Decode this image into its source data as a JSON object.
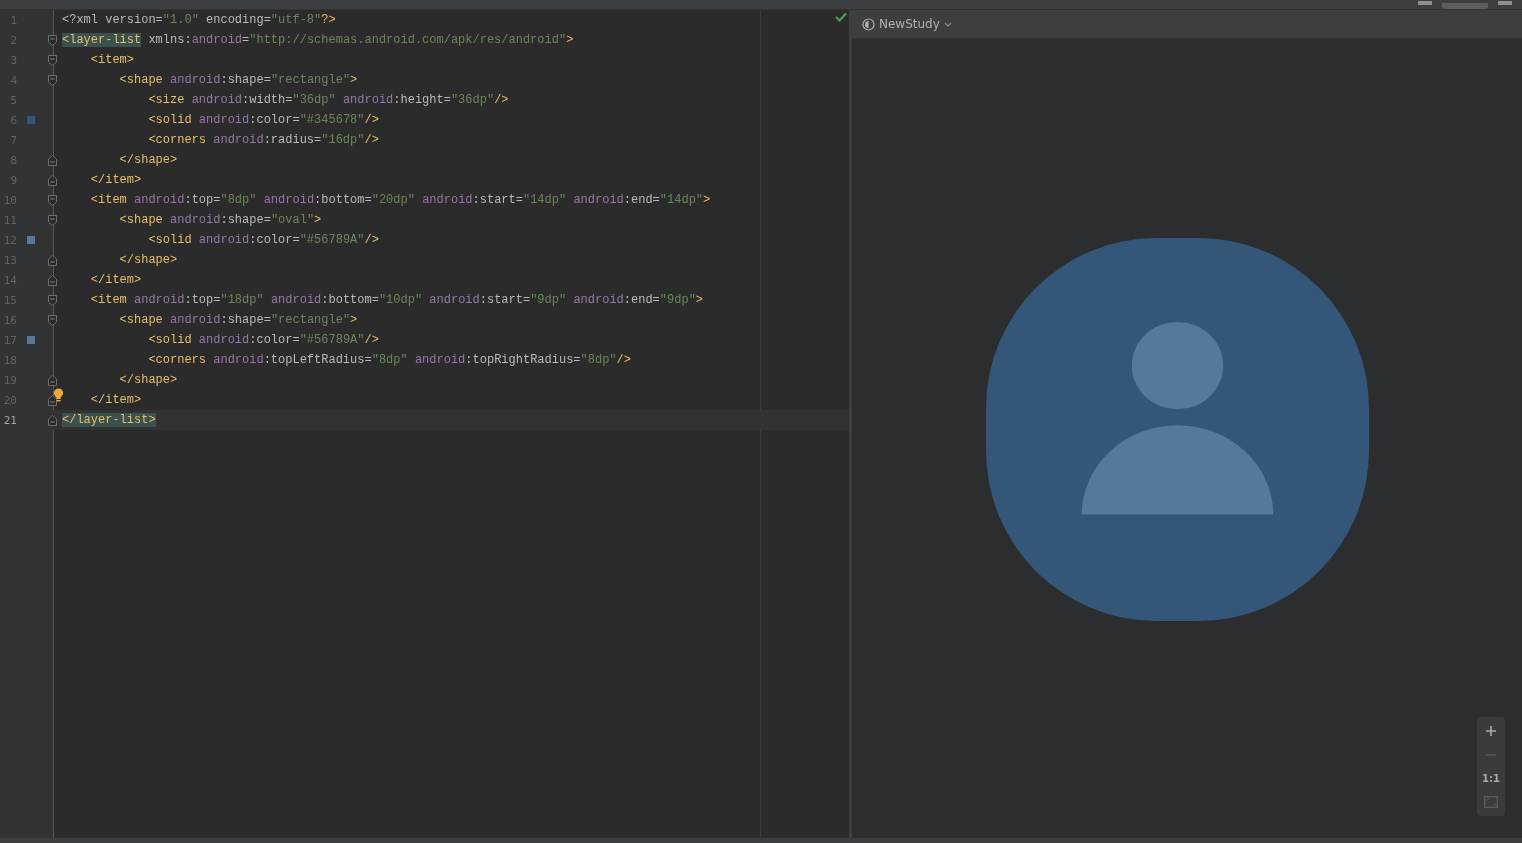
{
  "editor": {
    "lines": [
      {
        "number": "1",
        "kind": "plain",
        "bulb": false,
        "current": false,
        "tokens": [
          {
            "kind": "attr",
            "text": "<?xml version="
          },
          {
            "kind": "value",
            "text": "\"1.0\""
          },
          {
            "kind": "attr",
            "text": " encoding="
          },
          {
            "kind": "value",
            "text": "\"utf-8\""
          },
          {
            "kind": "tag",
            "text": "?>"
          }
        ]
      },
      {
        "number": "2",
        "kind": "open",
        "bulb": false,
        "current": false,
        "tokens": [
          {
            "kind": "match",
            "text": "<layer-list"
          },
          {
            "kind": "attr",
            "text": " xmlns:"
          },
          {
            "kind": "ns",
            "text": "android"
          },
          {
            "kind": "attr",
            "text": "="
          },
          {
            "kind": "value",
            "text": "\"http://schemas.android.com/apk/res/android\""
          },
          {
            "kind": "tag",
            "text": ">"
          }
        ]
      },
      {
        "number": "3",
        "kind": "open",
        "bulb": false,
        "current": false,
        "tokens": [
          {
            "kind": "tag",
            "text": "    <item>"
          }
        ]
      },
      {
        "number": "4",
        "kind": "open",
        "bulb": false,
        "current": false,
        "tokens": [
          {
            "kind": "tag",
            "text": "        <shape "
          },
          {
            "kind": "ns",
            "text": "android"
          },
          {
            "kind": "attr",
            "text": ":shape="
          },
          {
            "kind": "value",
            "text": "\"rectangle\""
          },
          {
            "kind": "tag",
            "text": ">"
          }
        ]
      },
      {
        "number": "5",
        "kind": "plain",
        "bulb": false,
        "current": false,
        "tokens": [
          {
            "kind": "tag",
            "text": "            <size "
          },
          {
            "kind": "ns",
            "text": "android"
          },
          {
            "kind": "attr",
            "text": ":width="
          },
          {
            "kind": "value",
            "text": "\"36dp\" "
          },
          {
            "kind": "ns",
            "text": "android"
          },
          {
            "kind": "attr",
            "text": ":height="
          },
          {
            "kind": "value",
            "text": "\"36dp\""
          },
          {
            "kind": "tag",
            "text": "/>"
          }
        ]
      },
      {
        "number": "6",
        "kind": "plain",
        "color": "#345678",
        "bulb": false,
        "current": false,
        "tokens": [
          {
            "kind": "tag",
            "text": "            <solid "
          },
          {
            "kind": "ns",
            "text": "android"
          },
          {
            "kind": "attr",
            "text": ":color="
          },
          {
            "kind": "value",
            "text": "\"#345678\""
          },
          {
            "kind": "tag",
            "text": "/>"
          }
        ]
      },
      {
        "number": "7",
        "kind": "plain",
        "bulb": false,
        "current": false,
        "tokens": [
          {
            "kind": "tag",
            "text": "            <corners "
          },
          {
            "kind": "ns",
            "text": "android"
          },
          {
            "kind": "attr",
            "text": ":radius="
          },
          {
            "kind": "value",
            "text": "\"16dp\""
          },
          {
            "kind": "tag",
            "text": "/>"
          }
        ]
      },
      {
        "number": "8",
        "kind": "close",
        "bulb": false,
        "current": false,
        "tokens": [
          {
            "kind": "tag",
            "text": "        </shape>"
          }
        ]
      },
      {
        "number": "9",
        "kind": "close",
        "bulb": false,
        "current": false,
        "tokens": [
          {
            "kind": "tag",
            "text": "    </item>"
          }
        ]
      },
      {
        "number": "10",
        "kind": "open",
        "bulb": false,
        "current": false,
        "tokens": [
          {
            "kind": "tag",
            "text": "    <item "
          },
          {
            "kind": "ns",
            "text": "android"
          },
          {
            "kind": "attr",
            "text": ":top="
          },
          {
            "kind": "value",
            "text": "\"8dp\" "
          },
          {
            "kind": "ns",
            "text": "android"
          },
          {
            "kind": "attr",
            "text": ":bottom="
          },
          {
            "kind": "value",
            "text": "\"20dp\" "
          },
          {
            "kind": "ns",
            "text": "android"
          },
          {
            "kind": "attr",
            "text": ":start="
          },
          {
            "kind": "value",
            "text": "\"14dp\" "
          },
          {
            "kind": "ns",
            "text": "android"
          },
          {
            "kind": "attr",
            "text": ":end="
          },
          {
            "kind": "value",
            "text": "\"14dp\""
          },
          {
            "kind": "tag",
            "text": ">"
          }
        ]
      },
      {
        "number": "11",
        "kind": "open",
        "bulb": false,
        "current": false,
        "tokens": [
          {
            "kind": "tag",
            "text": "        <shape "
          },
          {
            "kind": "ns",
            "text": "android"
          },
          {
            "kind": "attr",
            "text": ":shape="
          },
          {
            "kind": "value",
            "text": "\"oval\""
          },
          {
            "kind": "tag",
            "text": ">"
          }
        ]
      },
      {
        "number": "12",
        "kind": "plain",
        "color": "#56789a",
        "bulb": false,
        "current": false,
        "tokens": [
          {
            "kind": "tag",
            "text": "            <solid "
          },
          {
            "kind": "ns",
            "text": "android"
          },
          {
            "kind": "attr",
            "text": ":color="
          },
          {
            "kind": "value",
            "text": "\"#56789A\""
          },
          {
            "kind": "tag",
            "text": "/>"
          }
        ]
      },
      {
        "number": "13",
        "kind": "close",
        "bulb": false,
        "current": false,
        "tokens": [
          {
            "kind": "tag",
            "text": "        </shape>"
          }
        ]
      },
      {
        "number": "14",
        "kind": "close",
        "bulb": false,
        "current": false,
        "tokens": [
          {
            "kind": "tag",
            "text": "    </item>"
          }
        ]
      },
      {
        "number": "15",
        "kind": "open",
        "bulb": false,
        "current": false,
        "tokens": [
          {
            "kind": "tag",
            "text": "    <item "
          },
          {
            "kind": "ns",
            "text": "android"
          },
          {
            "kind": "attr",
            "text": ":top="
          },
          {
            "kind": "value",
            "text": "\"18dp\" "
          },
          {
            "kind": "ns",
            "text": "android"
          },
          {
            "kind": "attr",
            "text": ":bottom="
          },
          {
            "kind": "value",
            "text": "\"10dp\" "
          },
          {
            "kind": "ns",
            "text": "android"
          },
          {
            "kind": "attr",
            "text": ":start="
          },
          {
            "kind": "value",
            "text": "\"9dp\" "
          },
          {
            "kind": "ns",
            "text": "android"
          },
          {
            "kind": "attr",
            "text": ":end="
          },
          {
            "kind": "value",
            "text": "\"9dp\""
          },
          {
            "kind": "tag",
            "text": ">"
          }
        ]
      },
      {
        "number": "16",
        "kind": "open",
        "bulb": false,
        "current": false,
        "tokens": [
          {
            "kind": "tag",
            "text": "        <shape "
          },
          {
            "kind": "ns",
            "text": "android"
          },
          {
            "kind": "attr",
            "text": ":shape="
          },
          {
            "kind": "value",
            "text": "\"rectangle\""
          },
          {
            "kind": "tag",
            "text": ">"
          }
        ]
      },
      {
        "number": "17",
        "kind": "plain",
        "color": "#56789a",
        "bulb": false,
        "current": false,
        "tokens": [
          {
            "kind": "tag",
            "text": "            <solid "
          },
          {
            "kind": "ns",
            "text": "android"
          },
          {
            "kind": "attr",
            "text": ":color="
          },
          {
            "kind": "value",
            "text": "\"#56789A\""
          },
          {
            "kind": "tag",
            "text": "/>"
          }
        ]
      },
      {
        "number": "18",
        "kind": "plain",
        "bulb": false,
        "current": false,
        "tokens": [
          {
            "kind": "tag",
            "text": "            <corners "
          },
          {
            "kind": "ns",
            "text": "android"
          },
          {
            "kind": "attr",
            "text": ":topLeftRadius="
          },
          {
            "kind": "value",
            "text": "\"8dp\" "
          },
          {
            "kind": "ns",
            "text": "android"
          },
          {
            "kind": "attr",
            "text": ":topRightRadius="
          },
          {
            "kind": "value",
            "text": "\"8dp\""
          },
          {
            "kind": "tag",
            "text": "/>"
          }
        ]
      },
      {
        "number": "19",
        "kind": "close",
        "bulb": false,
        "current": false,
        "tokens": [
          {
            "kind": "tag",
            "text": "        </shape>"
          }
        ]
      },
      {
        "number": "20",
        "kind": "close",
        "bulb": true,
        "current": false,
        "tokens": [
          {
            "kind": "tag",
            "text": "    </item>"
          }
        ]
      },
      {
        "number": "21",
        "kind": "close",
        "bulb": false,
        "current": true,
        "tokens": [
          {
            "kind": "match",
            "text": "</layer-list>"
          }
        ]
      }
    ]
  },
  "preview": {
    "device": "NewStudy",
    "zoom_controls": {
      "actual_size": "1:1"
    }
  }
}
